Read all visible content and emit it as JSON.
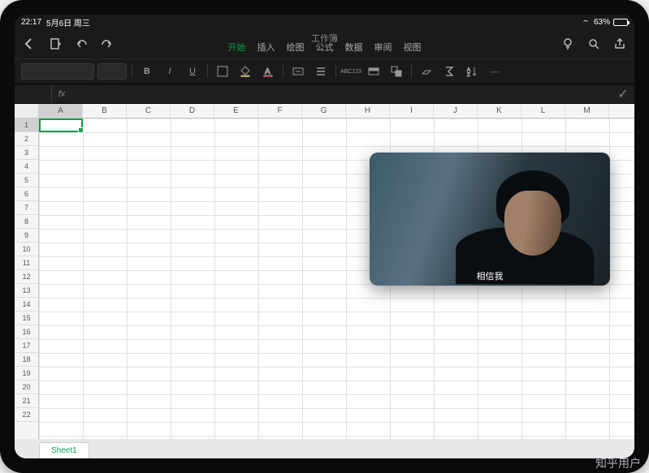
{
  "status": {
    "time": "22:17",
    "date": "5月6日 周三",
    "battery": "63%"
  },
  "doc_title": "工作簿",
  "tabs": [
    "开始",
    "插入",
    "绘图",
    "公式",
    "数据",
    "审阅",
    "视图"
  ],
  "active_tab": "开始",
  "toolbar": {
    "bold": "B",
    "italic": "I",
    "underline": "U",
    "abc": "ABC",
    "num": "123"
  },
  "columns": [
    "A",
    "B",
    "C",
    "D",
    "E",
    "F",
    "G",
    "H",
    "I",
    "J",
    "K",
    "L",
    "M"
  ],
  "rows": [
    "1",
    "2",
    "3",
    "4",
    "5",
    "6",
    "7",
    "8",
    "9",
    "10",
    "11",
    "12",
    "13",
    "14",
    "15",
    "16",
    "17",
    "18",
    "19",
    "20",
    "21",
    "22"
  ],
  "active_col": "A",
  "active_row": "1",
  "sheet": "Sheet1",
  "pip_subtitle": "相信我",
  "watermark": "知乎用户"
}
